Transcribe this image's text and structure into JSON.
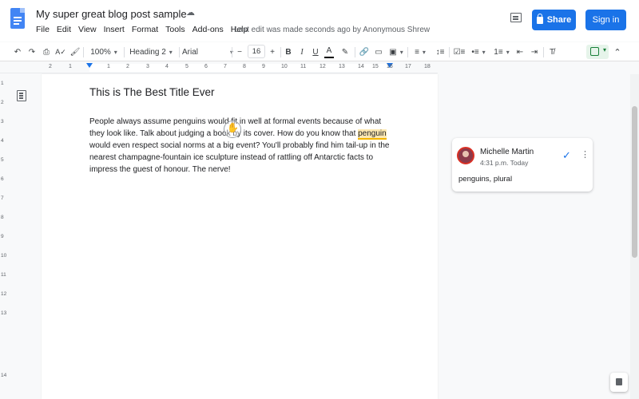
{
  "header": {
    "title": "My super great blog post sample",
    "menu": [
      "File",
      "Edit",
      "View",
      "Insert",
      "Format",
      "Tools",
      "Add-ons",
      "Help"
    ],
    "last_edit": "Last edit was made seconds ago by Anonymous Shrew",
    "share_label": "Share",
    "signin_label": "Sign in"
  },
  "toolbar": {
    "zoom": "100%",
    "style": "Heading 2",
    "font": "Arial",
    "font_size": "16",
    "minus": "−",
    "plus": "+",
    "bold": "B",
    "italic": "I",
    "underline": "U",
    "text_color": "A"
  },
  "ruler": {
    "numbers": [
      "2",
      "1",
      "1",
      "2",
      "3",
      "4",
      "5",
      "6",
      "7",
      "8",
      "9",
      "10",
      "11",
      "12",
      "13",
      "14",
      "15",
      "16",
      "17",
      "18"
    ]
  },
  "vruler": {
    "numbers": [
      "1",
      "2",
      "3",
      "4",
      "5",
      "6",
      "7",
      "8",
      "9",
      "10",
      "11",
      "12",
      "13",
      "14"
    ]
  },
  "document": {
    "heading": "This is The Best Title Ever",
    "para_before": "People always assume penguins would fit in well at formal events because of what they look like. Talk about judging a book by its cover. How do you know that ",
    "highlight": "penguin",
    "para_after": " would even respect social norms at a big event? You'll probably find him tail-up in the nearest champagne-fountain ice sculpture instead of rattling off Antarctic facts to impress the guest of honour. The nerve!"
  },
  "comment": {
    "author": "Michelle Martin",
    "time": "4:31 p.m. Today",
    "text": "penguins, plural"
  },
  "colors": {
    "accent": "#1a73e8",
    "highlight": "#fce8b2"
  }
}
